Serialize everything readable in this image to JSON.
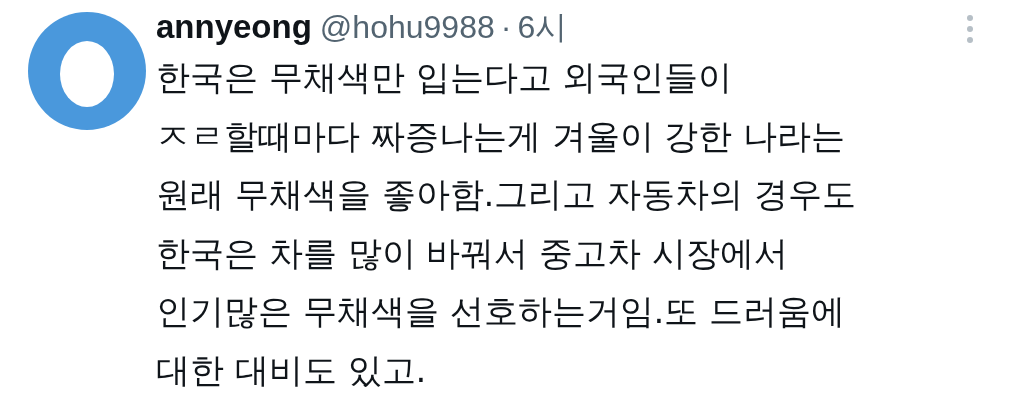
{
  "tweet": {
    "display_name": "annyeong",
    "handle": "@hohu9988",
    "separator": "·",
    "time": "6시",
    "lines": [
      "한국은 무채색만 입는다고 외국인들이",
      "ㅈㄹ할때마다 짜증나는게 겨울이 강한 나라는",
      "원래 무채색을 좋아함.그리고 자동차의 경우도",
      "한국은 차를 많이 바꿔서 중고차 시장에서",
      "인기많은 무채색을 선호하는거임.또 드러움에",
      "대한 대비도 있고."
    ]
  }
}
